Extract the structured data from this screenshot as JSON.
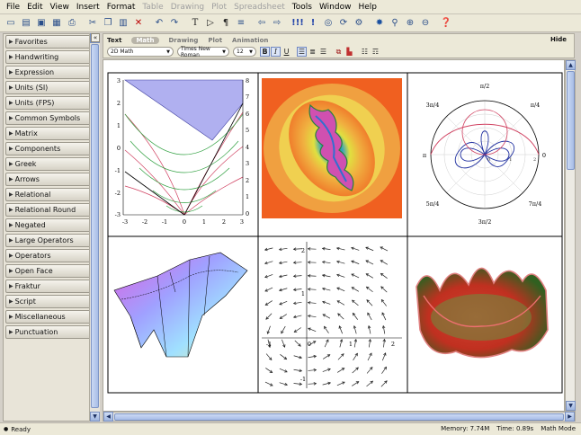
{
  "menubar": [
    "File",
    "Edit",
    "View",
    "Insert",
    "Format",
    "Table",
    "Drawing",
    "Plot",
    "Spreadsheet",
    "Tools",
    "Window",
    "Help"
  ],
  "menubar_disabled": [
    false,
    false,
    false,
    false,
    false,
    true,
    true,
    true,
    true,
    false,
    false,
    false
  ],
  "palettes": [
    "Favorites",
    "Handwriting",
    "Expression",
    "Units (SI)",
    "Units (FPS)",
    "Common Symbols",
    "Matrix",
    "Components",
    "Greek",
    "Arrows",
    "Relational",
    "Relational Round",
    "Negated",
    "Large Operators",
    "Operators",
    "Open Face",
    "Fraktur",
    "Script",
    "Miscellaneous",
    "Punctuation"
  ],
  "context": {
    "tabs": [
      "Text",
      "Math",
      "Drawing",
      "Plot",
      "Animation"
    ],
    "active_tab": "Math",
    "hide": "Hide",
    "style": "2D Math",
    "font": "Times New Roman",
    "size": "12",
    "bold": "B",
    "italic": "I",
    "underline": "U"
  },
  "plots": {
    "p1": {
      "xticks": [
        "-3",
        "-2",
        "-1",
        "0",
        "1",
        "2",
        "3"
      ],
      "yticks": [
        "3",
        "2",
        "1",
        "0",
        "-1",
        "-2",
        "-3"
      ],
      "y2ticks": [
        "8",
        "7",
        "6",
        "5",
        "4",
        "3",
        "2",
        "1",
        "0"
      ]
    },
    "p3": {
      "labels": [
        "π/2",
        "3π/4",
        "π/4",
        "π",
        "0",
        "5π/4",
        "7π/4",
        "3π/2"
      ],
      "r_ticks": [
        "0",
        "1",
        "2"
      ]
    },
    "p5": {
      "xticks": [
        "-1",
        "1",
        "2"
      ],
      "yticks": [
        "2",
        "1",
        "-1"
      ],
      "origin": "0"
    }
  },
  "status": {
    "left": "Ready",
    "memory": "Memory: 7.74M",
    "time": "Time: 0.89s",
    "mode": "Math Mode"
  },
  "colors": {
    "accent": "#2a4e8a",
    "ui_bg": "#ece9d8"
  }
}
